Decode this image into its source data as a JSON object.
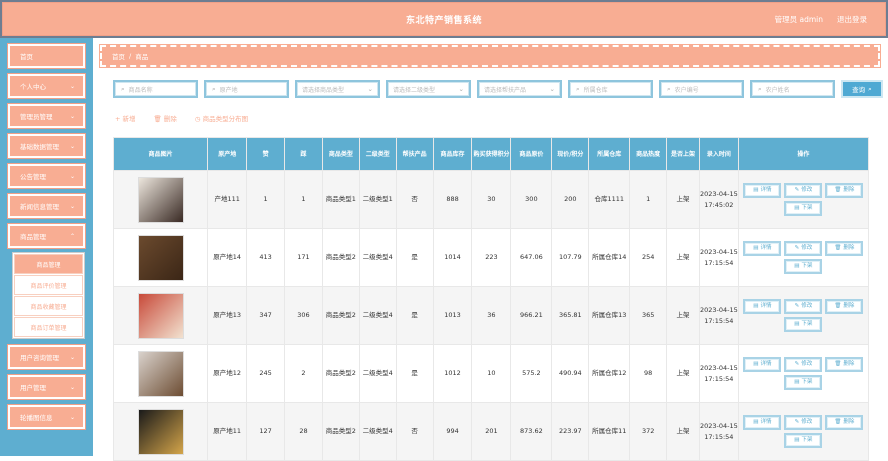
{
  "header": {
    "title": "东北特产销售系统",
    "user": "管理员 admin",
    "logout": "退出登录"
  },
  "sidebar": {
    "items": [
      {
        "label": "首页"
      },
      {
        "label": "个人中心"
      },
      {
        "label": "管理员管理"
      },
      {
        "label": "基础数据管理"
      },
      {
        "label": "公告管理"
      },
      {
        "label": "新闻信息管理"
      },
      {
        "label": "商品管理"
      },
      {
        "label": "用户咨询管理"
      },
      {
        "label": "用户管理"
      },
      {
        "label": "轮播图信息"
      }
    ],
    "submenu": [
      {
        "label": "商品管理"
      },
      {
        "label": "商品评价管理"
      },
      {
        "label": "商品收藏管理"
      },
      {
        "label": "商品订单管理"
      }
    ]
  },
  "breadcrumb": {
    "home": "首页",
    "sep": "/",
    "current": "商品"
  },
  "search": {
    "name": "商品名称",
    "origin": "原产地",
    "type": "请选择商品类型",
    "type2": "请选择二级类型",
    "poverty": "请选择帮扶产品",
    "warehouse": "所属仓库",
    "farmer_no": "农户编号",
    "farmer_name": "农户姓名",
    "button": "查询"
  },
  "toolbar": {
    "add": "新增",
    "delete": "删除",
    "chart": "商品类型分布图"
  },
  "table": {
    "headers": [
      "商品图片",
      "原产地",
      "赞",
      "踩",
      "商品类型",
      "二级类型",
      "帮扶产品",
      "商品库存",
      "购买获得积分",
      "商品原价",
      "现价/积分",
      "所属仓库",
      "商品热度",
      "是否上架",
      "录入时间",
      "操作"
    ],
    "ops": {
      "detail": "详情",
      "edit": "修改",
      "delete": "删除",
      "off": "下架"
    },
    "rows": [
      {
        "origin": "产地111",
        "like": "1",
        "dislike": "1",
        "type": "商品类型1",
        "type2": "二级类型1",
        "poverty": "否",
        "stock": "888",
        "points": "30",
        "price": "300",
        "now": "200",
        "warehouse": "仓库1111",
        "heat": "1",
        "onsale": "上架",
        "time": "2023-04-15 17:45:02"
      },
      {
        "origin": "原产地14",
        "like": "413",
        "dislike": "171",
        "type": "商品类型2",
        "type2": "二级类型4",
        "poverty": "是",
        "stock": "1014",
        "points": "223",
        "price": "647.06",
        "now": "107.79",
        "warehouse": "所属仓库14",
        "heat": "254",
        "onsale": "上架",
        "time": "2023-04-15 17:15:54"
      },
      {
        "origin": "原产地13",
        "like": "347",
        "dislike": "306",
        "type": "商品类型2",
        "type2": "二级类型4",
        "poverty": "是",
        "stock": "1013",
        "points": "36",
        "price": "966.21",
        "now": "365.81",
        "warehouse": "所属仓库13",
        "heat": "365",
        "onsale": "上架",
        "time": "2023-04-15 17:15:54"
      },
      {
        "origin": "原产地12",
        "like": "245",
        "dislike": "2",
        "type": "商品类型2",
        "type2": "二级类型4",
        "poverty": "是",
        "stock": "1012",
        "points": "10",
        "price": "575.2",
        "now": "490.94",
        "warehouse": "所属仓库12",
        "heat": "98",
        "onsale": "上架",
        "time": "2023-04-15 17:15:54"
      },
      {
        "origin": "原产地11",
        "like": "127",
        "dislike": "28",
        "type": "商品类型2",
        "type2": "二级类型4",
        "poverty": "否",
        "stock": "994",
        "points": "201",
        "price": "873.62",
        "now": "223.97",
        "warehouse": "所属仓库11",
        "heat": "372",
        "onsale": "上架",
        "time": "2023-04-15 17:15:54"
      }
    ]
  },
  "colors": {
    "accent": "#f8ad93",
    "primary": "#5eaed0"
  }
}
